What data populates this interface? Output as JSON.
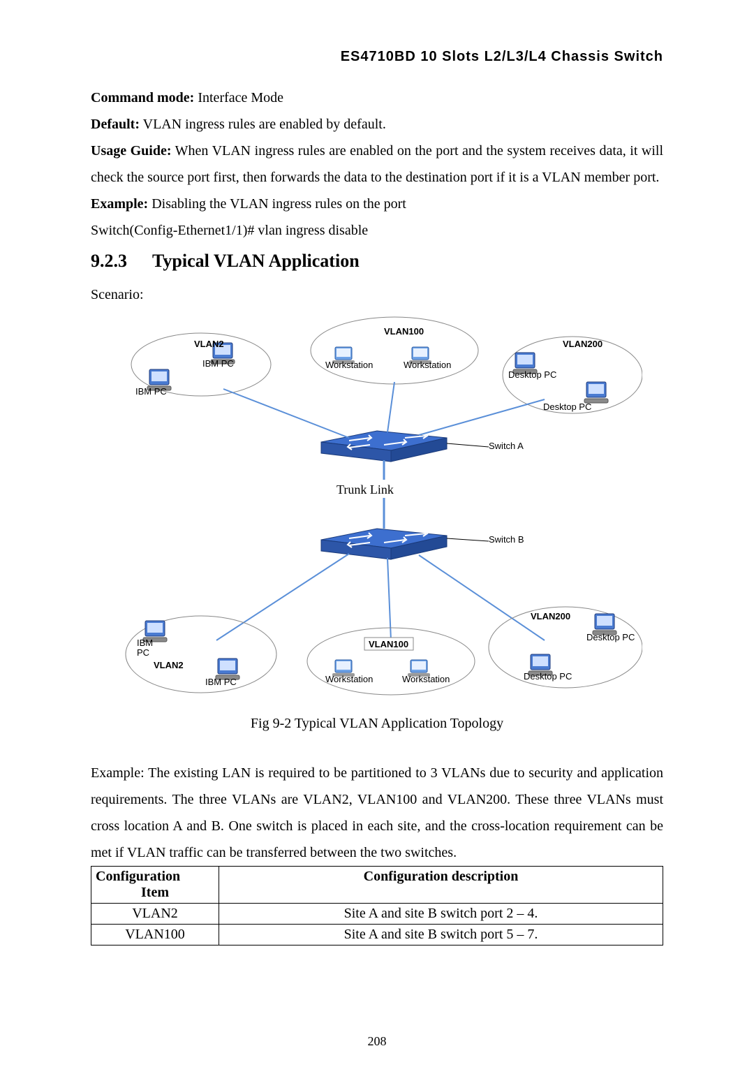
{
  "header": "ES4710BD 10 Slots L2/L3/L4 Chassis Switch",
  "body": {
    "p1_bold": "Command mode:",
    "p1_rest": " Interface Mode",
    "p2_bold": "Default:",
    "p2_rest": " VLAN ingress rules are enabled by default.",
    "p3_bold": "Usage Guide:",
    "p3_rest": " When VLAN ingress rules are enabled on the port and the system receives data, it will check the source port first, then forwards the data to the destination port if it is a VLAN member port.",
    "p4_bold": "Example:",
    "p4_rest": " Disabling the VLAN ingress rules on the port",
    "p5": "Switch(Config-Ethernet1/1)# vlan ingress disable",
    "h2_num": "9.2.3",
    "h2_txt": "Typical VLAN Application",
    "scenario": "Scenario:",
    "figcap": "Fig 9-2   Typical VLAN Application Topology",
    "example2": "Example: The existing LAN is required to be partitioned to 3 VLANs due to security and application requirements. The three VLANs are VLAN2, VLAN100 and VLAN200. These three VLANs must cross location A and B. One switch is placed in each site, and the cross-location requirement can be met if VLAN traffic can be transferred between the two switches."
  },
  "table": {
    "h1a": "Configuration",
    "h1b": "Item",
    "h2": "Configuration description",
    "rows": [
      {
        "c1": "VLAN2",
        "c2": "Site A and site B switch port 2 – 4."
      },
      {
        "c1": "VLAN100",
        "c2": "Site A and site B switch port 5 – 7."
      }
    ]
  },
  "diagram": {
    "vlan2": "VLAN2",
    "vlan100": "VLAN100",
    "vlan200": "VLAN200",
    "ibmpc": "IBM PC",
    "workstation": "Workstation",
    "desktoppc": "Desktop PC",
    "switchA": "Switch A",
    "switchB": "Switch B",
    "trunk": "Trunk Link",
    "ibm": "IBM",
    "pc": "PC"
  },
  "pagenum": "208"
}
